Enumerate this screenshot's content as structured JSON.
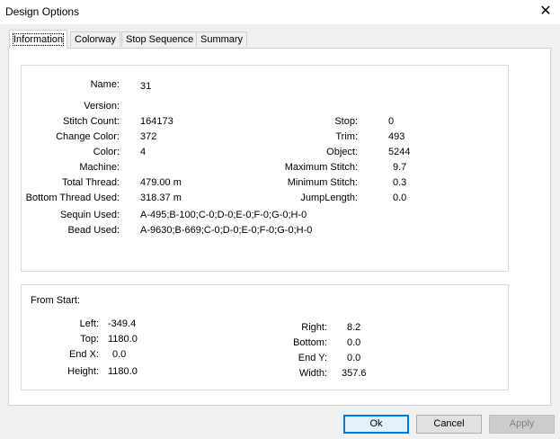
{
  "window": {
    "title": "Design Options",
    "close_glyph": "✕"
  },
  "tabs": [
    "Information",
    "Colorway",
    "Stop Sequence",
    "Summary"
  ],
  "info": {
    "name_label": "Name:",
    "name_value": "31",
    "version_label": "Version:",
    "version_value": "",
    "stitch_count_label": "Stitch Count:",
    "stitch_count_value": "164173",
    "change_color_label": "Change Color:",
    "change_color_value": "372",
    "color_label": "Color:",
    "color_value": "4",
    "machine_label": "Machine:",
    "machine_value": "",
    "total_thread_label": "Total Thread:",
    "total_thread_value": "479.00 m",
    "bottom_thread_label": "Bottom Thread Used:",
    "bottom_thread_value": "318.37 m",
    "sequin_label": "Sequin Used:",
    "sequin_value": "A-495;B-100;C-0;D-0;E-0;F-0;G-0;H-0",
    "bead_label": "Bead Used:",
    "bead_value": "A-9630;B-669;C-0;D-0;E-0;F-0;G-0;H-0",
    "stop_label": "Stop:",
    "stop_value": "0",
    "trim_label": "Trim:",
    "trim_value": "493",
    "object_label": "Object:",
    "object_value": "5244",
    "max_stitch_label": "Maximum Stitch:",
    "max_stitch_value": "9.7",
    "min_stitch_label": "Minimum Stitch:",
    "min_stitch_value": "0.3",
    "jump_length_label": "JumpLength:",
    "jump_length_value": "0.0"
  },
  "from_start": {
    "title": "From Start:",
    "left_label": "Left:",
    "left_value": "-349.4",
    "top_label": "Top:",
    "top_value": "1180.0",
    "endx_label": "End X:",
    "endx_value": "0.0",
    "height_label": "Height:",
    "height_value": "1180.0",
    "right_label": "Right:",
    "right_value": "8.2",
    "bottom_label": "Bottom:",
    "bottom_value": "0.0",
    "endy_label": "End Y:",
    "endy_value": "0.0",
    "width_label": "Width:",
    "width_value": "357.6"
  },
  "buttons": {
    "ok": "Ok",
    "cancel": "Cancel",
    "apply": "Apply"
  }
}
